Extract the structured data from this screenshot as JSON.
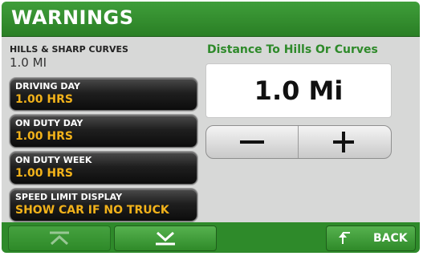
{
  "header": {
    "title": "WARNINGS"
  },
  "info": {
    "label": "HILLS & SHARP CURVES",
    "value": "1.0 MI"
  },
  "settings": [
    {
      "label": "DRIVING DAY",
      "value": "1.00 HRS"
    },
    {
      "label": "ON DUTY DAY",
      "value": "1.00 HRS"
    },
    {
      "label": "ON DUTY WEEK",
      "value": "1.00 HRS"
    },
    {
      "label": "SPEED LIMIT DISPLAY",
      "value": "SHOW CAR IF NO TRUCK"
    }
  ],
  "detail": {
    "title": "Distance To Hills Or Curves",
    "value": "1.0 Mi"
  },
  "footer": {
    "back_label": "BACK"
  },
  "icons": {
    "up": "scroll-up-icon",
    "down": "scroll-down-icon",
    "back": "back-arrow-icon"
  },
  "colors": {
    "accent_green": "#2e8a2a",
    "value_orange": "#f2b21a"
  }
}
